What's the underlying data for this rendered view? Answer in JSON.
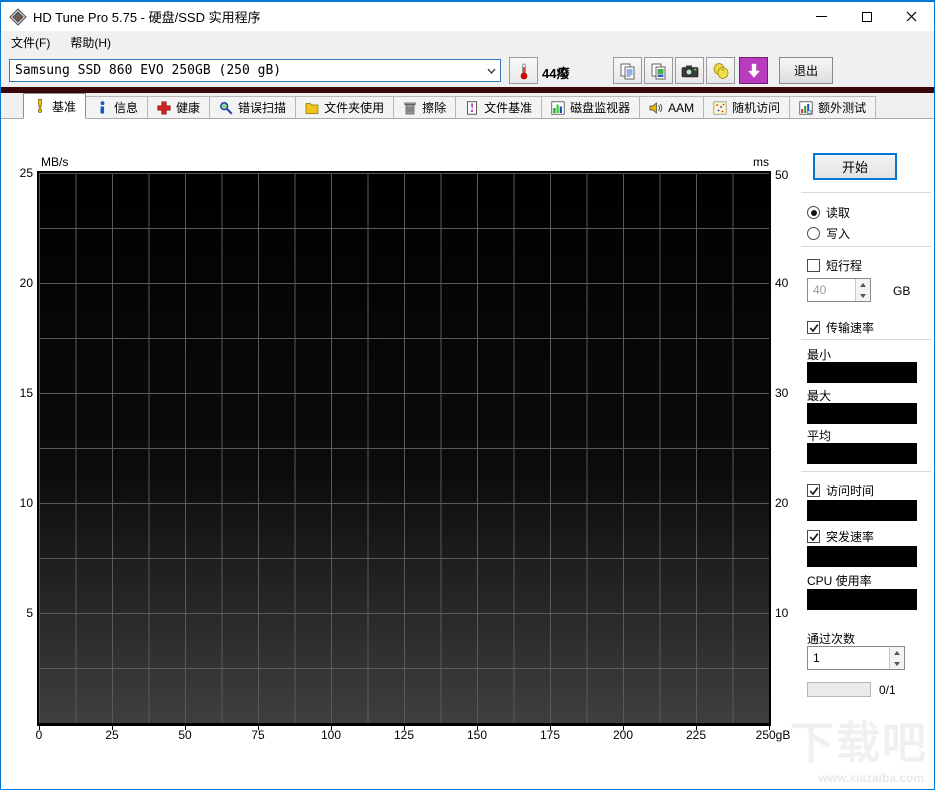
{
  "window": {
    "title": "HD Tune Pro 5.75 - 硬盘/SSD 实用程序"
  },
  "menu": {
    "file": "文件(F)",
    "help": "帮助(H)"
  },
  "toolbar": {
    "drive_selector_value": "Samsung SSD 860 EVO 250GB (250 gB)",
    "temperature": "44癈",
    "exit_label": "退出"
  },
  "tabs": {
    "active": "基准",
    "items": [
      "基准",
      "信息",
      "健康",
      "错误扫描",
      "文件夹使用",
      "擦除",
      "文件基准",
      "磁盘监视器",
      "AAM",
      "随机访问",
      "额外测试"
    ]
  },
  "chart_data": {
    "type": "line",
    "series": [],
    "x_axis": {
      "unit": "GB",
      "range": [
        0,
        250
      ],
      "ticks": [
        "0",
        "25",
        "50",
        "75",
        "100",
        "125",
        "150",
        "175",
        "200",
        "225",
        "250gB"
      ]
    },
    "left_axis": {
      "label": "MB/s",
      "range": [
        0,
        25
      ],
      "ticks": [
        "25",
        "20",
        "15",
        "10",
        "5"
      ]
    },
    "right_axis": {
      "label": "ms",
      "range": [
        0,
        50
      ],
      "ticks": [
        "50",
        "40",
        "30",
        "20",
        "10"
      ]
    },
    "grid": true
  },
  "panel": {
    "start": "开始",
    "read": "读取",
    "write": "写入",
    "short_stroke": "短行程",
    "short_stroke_value": "40",
    "short_stroke_unit": "GB",
    "transfer_rate": "传输速率",
    "min": "最小",
    "max": "最大",
    "avg": "平均",
    "access_time": "访问时间",
    "burst_rate": "突发速率",
    "cpu_usage": "CPU 使用率",
    "pass_count": "通过次数",
    "pass_count_value": "1",
    "progress": "0/1"
  },
  "watermark": {
    "brand": "下载吧",
    "site": "www.xiazaiba.com"
  },
  "colors": {
    "accent": "#0078d7",
    "band": "#3a0808",
    "download_button": "#b93cbe",
    "chart_bg_top": "#000000",
    "chart_bg_bottom": "#3f3f3f",
    "grid_line": "#5a5a5a"
  }
}
